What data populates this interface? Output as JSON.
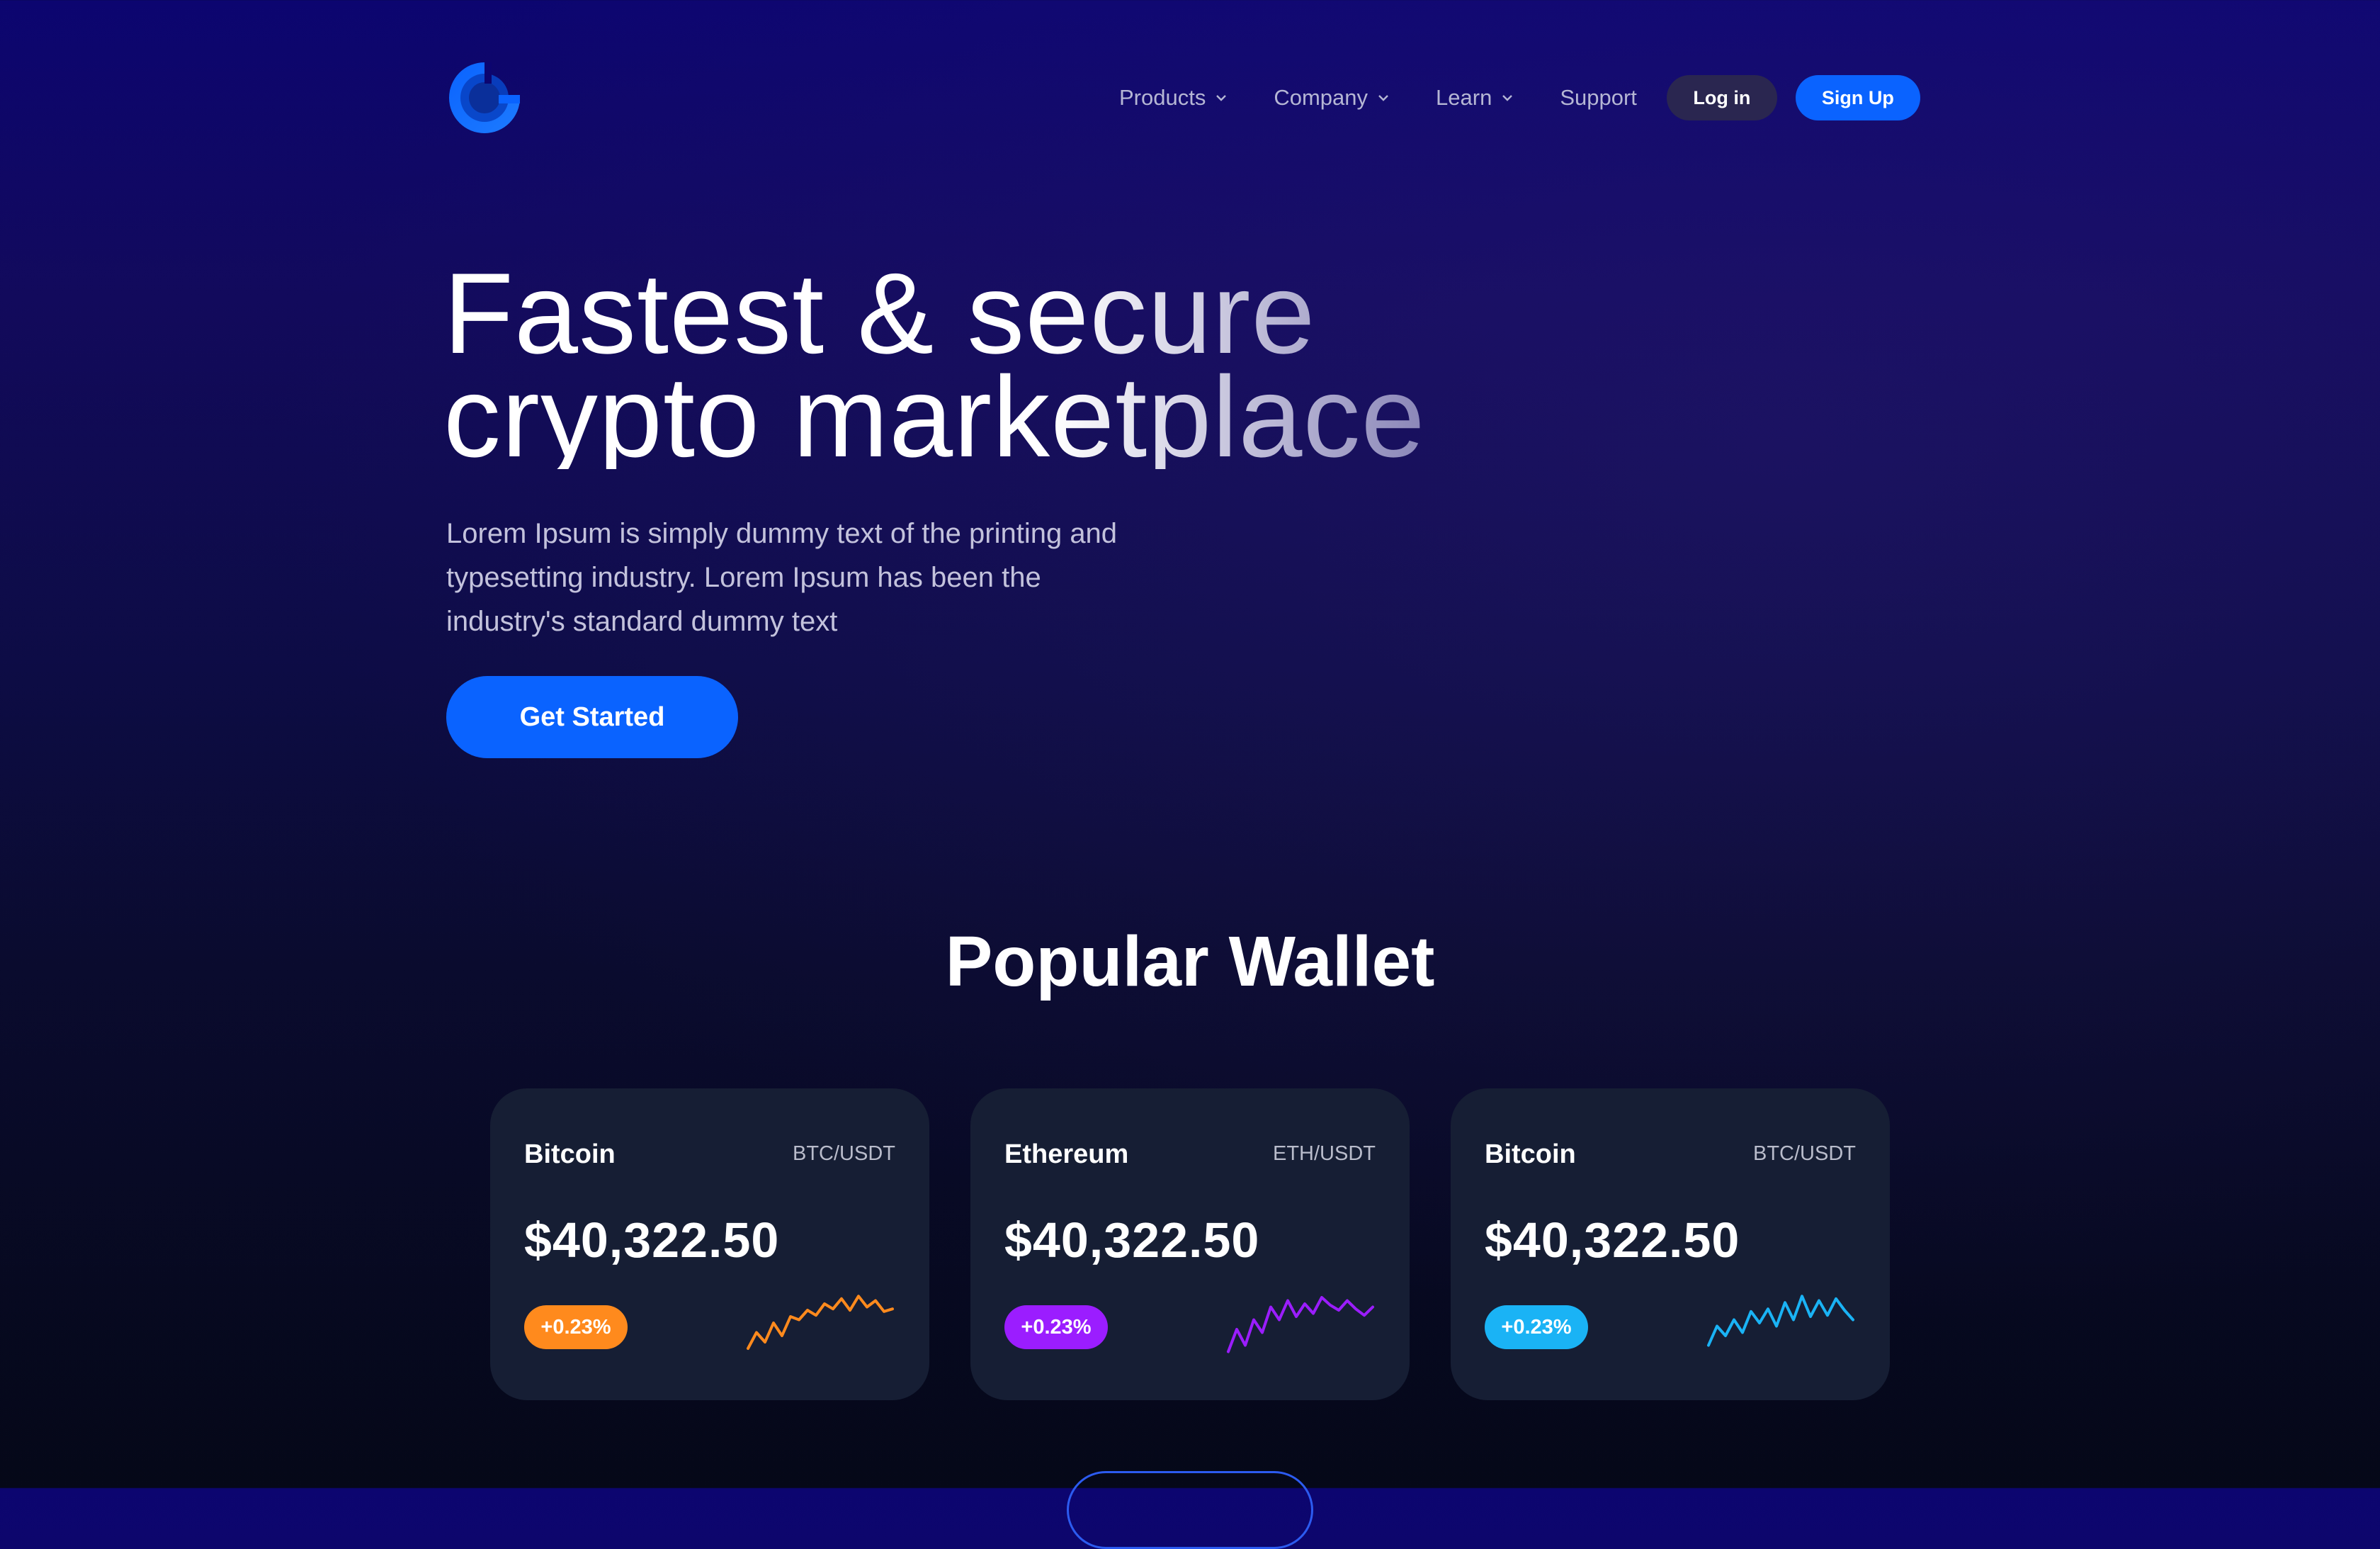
{
  "nav": {
    "items": [
      {
        "label": "Products",
        "has_dropdown": true
      },
      {
        "label": "Company",
        "has_dropdown": true
      },
      {
        "label": "Learn",
        "has_dropdown": true
      },
      {
        "label": "Support",
        "has_dropdown": false
      }
    ],
    "login_label": "Log in",
    "signup_label": "Sign Up"
  },
  "hero": {
    "title_line1": "Fastest & secure",
    "title_line2": "crypto marketplace",
    "subtitle_line1": "Lorem Ipsum is simply dummy text of the printing and",
    "subtitle_line2": "typesetting industry. Lorem Ipsum has been the",
    "subtitle_line3": "industry's standard dummy text",
    "cta_label": "Get Started"
  },
  "wallet": {
    "title": "Popular Wallet",
    "cards": [
      {
        "name": "Bitcoin",
        "pair": "BTC/USDT",
        "price": "$40,322.50",
        "change": "+0.23%",
        "color": "#ff8a1d",
        "icon": "sparkline-chart-icon",
        "trend": [
          0.1,
          0.35,
          0.2,
          0.5,
          0.3,
          0.6,
          0.55,
          0.7,
          0.62,
          0.8,
          0.72,
          0.88,
          0.7,
          0.92,
          0.75,
          0.85,
          0.68,
          0.72
        ]
      },
      {
        "name": "Ethereum",
        "pair": "ETH/USDT",
        "price": "$40,322.50",
        "change": "+0.23%",
        "color": "#9b1dff",
        "icon": "sparkline-chart-icon",
        "trend": [
          0.05,
          0.4,
          0.15,
          0.55,
          0.35,
          0.75,
          0.55,
          0.85,
          0.6,
          0.8,
          0.65,
          0.9,
          0.78,
          0.7,
          0.85,
          0.72,
          0.62,
          0.75
        ]
      },
      {
        "name": "Bitcoin",
        "pair": "BTC/USDT",
        "price": "$40,322.50",
        "change": "+0.23%",
        "color": "#1ab3f5",
        "icon": "sparkline-chart-icon",
        "trend": [
          0.15,
          0.45,
          0.3,
          0.55,
          0.35,
          0.68,
          0.5,
          0.72,
          0.45,
          0.82,
          0.55,
          0.92,
          0.6,
          0.85,
          0.62,
          0.88,
          0.7,
          0.55
        ]
      }
    ]
  },
  "colors": {
    "accent": "#0a63ff",
    "background": "#0c0570"
  }
}
